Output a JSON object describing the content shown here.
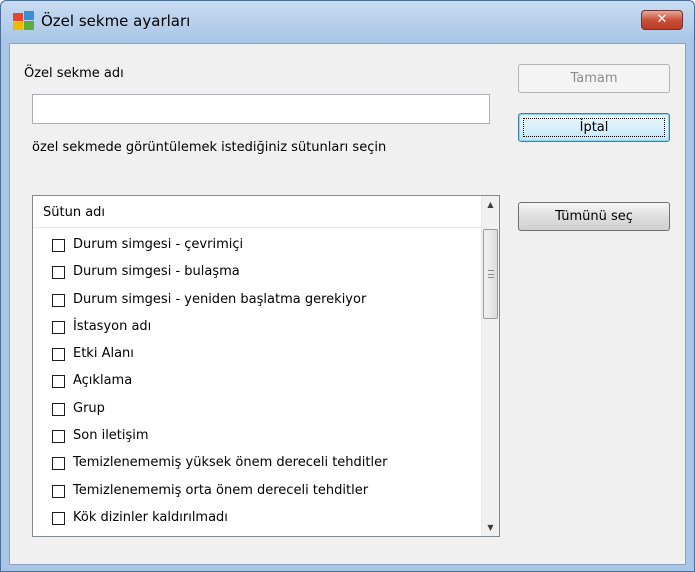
{
  "window": {
    "title": "Özel sekme ayarları",
    "close_label": "✕",
    "app_icon": "avg-logo-icon"
  },
  "form": {
    "name_label": "Özel sekme adı",
    "name_value": "",
    "hint_label": "özel sekmede görüntülemek istediğiniz sütunları seçin"
  },
  "buttons": {
    "ok": "Tamam",
    "cancel": "İptal",
    "select_all": "Tümünü seç"
  },
  "list": {
    "header": "Sütun adı",
    "items": [
      {
        "label": "Durum simgesi - çevrimiçi",
        "checked": false
      },
      {
        "label": "Durum simgesi - bulaşma",
        "checked": false
      },
      {
        "label": "Durum simgesi - yeniden başlatma gerekiyor",
        "checked": false
      },
      {
        "label": "İstasyon adı",
        "checked": false
      },
      {
        "label": "Etki Alanı",
        "checked": false
      },
      {
        "label": "Açıklama",
        "checked": false
      },
      {
        "label": "Grup",
        "checked": false
      },
      {
        "label": "Son iletişim",
        "checked": false
      },
      {
        "label": "Temizlenememiş yüksek önem dereceli tehditler",
        "checked": false
      },
      {
        "label": "Temizlenememiş orta önem dereceli tehditler",
        "checked": false
      },
      {
        "label": "Kök dizinler kaldırılmadı",
        "checked": false
      }
    ],
    "scroll_up_icon": "scroll-up-arrow-icon",
    "scroll_down_icon": "scroll-down-arrow-icon"
  },
  "colors": {
    "close_button": "#c9513a",
    "title_bar": "#a9c6e6",
    "dialog_bg": "#f0f0f0",
    "focused_button_border": "#3c7fb1"
  }
}
